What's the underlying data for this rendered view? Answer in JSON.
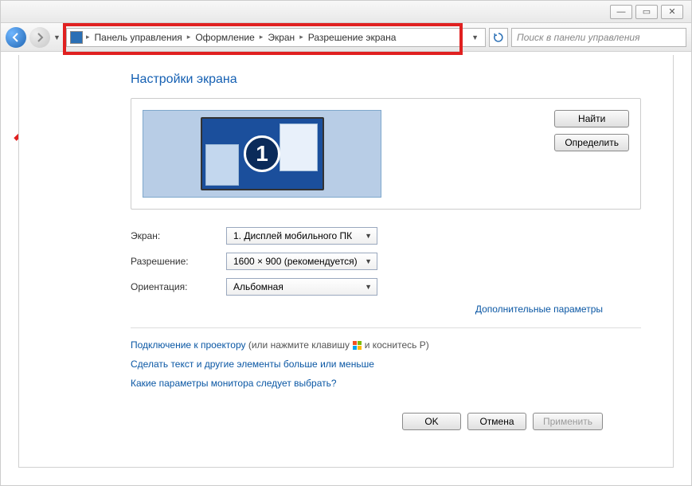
{
  "window_controls": {
    "min": "—",
    "max": "▭",
    "close": "✕"
  },
  "breadcrumb": {
    "items": [
      "Панель управления",
      "Оформление",
      "Экран",
      "Разрешение экрана"
    ]
  },
  "search": {
    "placeholder": "Поиск в панели управления"
  },
  "page": {
    "title": "Настройки экрана",
    "monitor_number": "1",
    "find_button": "Найти",
    "detect_button": "Определить",
    "fields": {
      "display_label": "Экран:",
      "display_value": "1. Дисплей мобильного ПК",
      "resolution_label": "Разрешение:",
      "resolution_value": "1600 × 900 (рекомендуется)",
      "orientation_label": "Ориентация:",
      "orientation_value": "Альбомная"
    },
    "advanced_link": "Дополнительные параметры",
    "projector_link": "Подключение к проектору",
    "projector_hint_a": "(или нажмите клавишу",
    "projector_hint_b": "и коснитесь P)",
    "text_size_link": "Сделать текст и другие элементы больше или меньше",
    "which_settings_link": "Какие параметры монитора следует выбрать?",
    "ok_button": "OK",
    "cancel_button": "Отмена",
    "apply_button": "Применить"
  }
}
